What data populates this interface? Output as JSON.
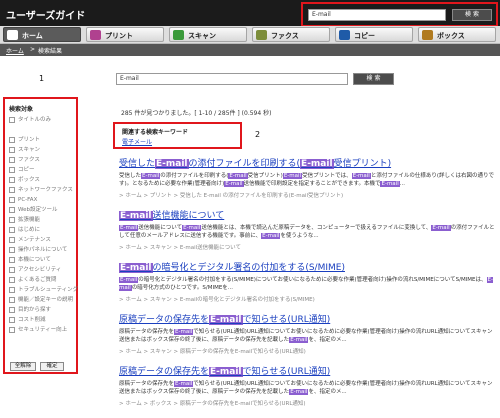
{
  "header": {
    "title": "ユーザーズガイド",
    "search_value": "E-mail",
    "search_button": "検 索"
  },
  "nav": {
    "tabs": [
      {
        "label": "ホーム",
        "color": "#ffffff"
      },
      {
        "label": "プリント",
        "color": "#b0418f"
      },
      {
        "label": "スキャン",
        "color": "#3a9a3a"
      },
      {
        "label": "ファクス",
        "color": "#7c8d3a"
      },
      {
        "label": "コピー",
        "color": "#1f5ba8"
      },
      {
        "label": "ボックス",
        "color": "#b07a1f"
      }
    ]
  },
  "breadcrumb": {
    "home": "ホーム",
    "sep": ">",
    "current": "検索結果"
  },
  "annotations": {
    "n1": "1",
    "n2": "2"
  },
  "sidebar": {
    "heading": "検索対象",
    "items": [
      "タイトルのみ",
      "プリント",
      "スキャン",
      "ファクス",
      "コピー",
      "ボックス",
      "ネットワークファクス",
      "PC-FAX",
      "Web設定ツール",
      "拡張機能",
      "はじめに",
      "メンテナンス",
      "操作パネルについて",
      "本機について",
      "アクセシビリティ",
      "よくあるご質問",
      "トラブルシューティング",
      "機能／設定キーの説明",
      "目的から探す",
      "コスト削減",
      "セキュリティー向上"
    ],
    "select_all": "全解除",
    "confirm": "確定"
  },
  "main": {
    "search_value": "E-mail",
    "search_button": "検 索",
    "result_count": "285 件が見つかりました。[ 1-10 / 285件 ] (0.594 秒)",
    "related_title": "関連する検索キーワード",
    "related_link": "電子メール",
    "results": [
      {
        "title": [
          "受信した",
          "E-mail",
          "の添付ファイルを印刷する(",
          "E-mail",
          "受信プリント)"
        ],
        "snippet": [
          "受信した",
          "E-mail",
          "の添付ファイルを印刷する(",
          "E-mail",
          "受信プリント)",
          "E-mail",
          "受信プリントでは、",
          "E-mail",
          "と添付ファイルの仕様あり(詳しくは右図の通りです)。となるために必要な作業(管理者向け)",
          "E-mail",
          "送信機能で印刷設定を指定することができます。本機で",
          "E-mail",
          "..."
        ],
        "path": "> ホーム > プリント > 受信した E-mail の添付ファイルを印刷する(E-mail受信プリント)"
      },
      {
        "title": [
          "",
          "E-mail",
          "送信機能について",
          "",
          ""
        ],
        "snippet": [
          "",
          "E-mail",
          "送信機能について",
          "E-mail",
          "送信機能とは、本機で読込んだ原稿データを、コンピューターで扱えるファイルに変換して、",
          "E-mail",
          "の添付ファイルとして任意のメールアドレスに送信する機能です。事前に、",
          "E-mail",
          "を使うような...",
          "",
          "",
          "",
          ""
        ],
        "path": "> ホーム > スキャン > E-mail送信機能について"
      },
      {
        "title": [
          "",
          "E-mail",
          "の暗号化とデジタル署名の付加をする(S/MIME)",
          "",
          ""
        ],
        "snippet": [
          "",
          "E-mail",
          "の暗号化とデジタル署名の付加をする(S/MIME)についてお使いになるために必要な作業(管理者向け)操作の流れS/MIMEについてS/MIMEは、",
          "E-mail",
          "の暗号化方式のひとつです。S/MIMEを...",
          "",
          "",
          "",
          "",
          "",
          "",
          "",
          ""
        ],
        "path": "> ホーム > スキャン > E-mailの暗号化とデジタル署名の付加をする(S/MIME)"
      },
      {
        "title": [
          "原稿データの保存先を",
          "E-mail",
          "で知らせる(URL通知)",
          "",
          ""
        ],
        "snippet": [
          "原稿データの保存先を",
          "E-mail",
          "で知らせる(URL通知)URL通知についてお使いになるために必要な作業(管理者向け)操作の流れURL通知についてスキャン送信またはボックス保存の終了後に、原稿データの保存先を記載した",
          "E-mail",
          "を、指定のメ...",
          "",
          "",
          "",
          "",
          "",
          "",
          "",
          ""
        ],
        "path": "> ホーム > スキャン > 原稿データの保存先をE-mailで知らせる(URL通知)"
      },
      {
        "title": [
          "原稿データの保存先を",
          "E-mail",
          "で知らせる(URL通知)",
          "",
          ""
        ],
        "snippet": [
          "原稿データの保存先を",
          "E-mail",
          "で知らせる(URL通知)URL通知についてお使いになるために必要な作業(管理者向け)操作の流れURL通知についてスキャン送信またはボックス保存の終了後に、原稿データの保存先を記載した",
          "E-mail",
          "を、指定のメ...",
          "",
          "",
          "",
          "",
          "",
          "",
          "",
          ""
        ],
        "path": "> ホーム > ボックス > 原稿データの保存先をE-mailで知らせる(URL通知)"
      }
    ]
  }
}
